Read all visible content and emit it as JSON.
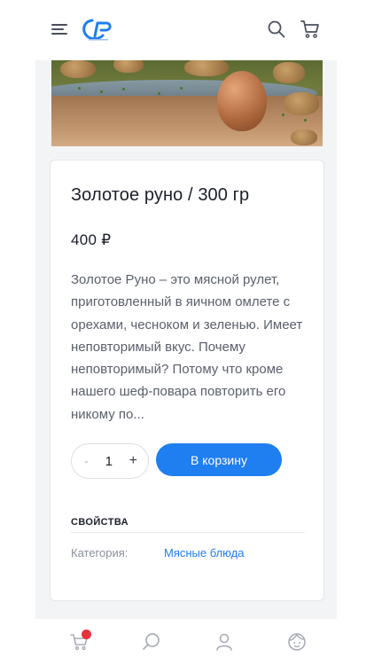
{
  "header": {
    "menu_icon": "hamburger-menu-icon",
    "logo_icon": "brand-logo-icon",
    "search_icon": "search-icon",
    "cart_icon": "cart-icon"
  },
  "product": {
    "title": "Золотое руно / 300 гр",
    "price": "400 ₽",
    "description": "Золотое Руно – это мясной рулет, приготовленный в яичном омлете с орехами, чесноком и зеленью. Имеет неповторимый вкус. Почему неповторимый? Потому что кроме нашего шеф-повара повторить его никому по...",
    "quantity": {
      "minus": "-",
      "value": "1",
      "plus": "+"
    },
    "add_to_cart": "В корзину",
    "properties": {
      "title": "СВОЙСТВА",
      "category_label": "Категория:",
      "category_value": "Мясные блюда"
    }
  },
  "tabbar": {
    "items": [
      {
        "icon": "cart-icon"
      },
      {
        "icon": "search-icon"
      },
      {
        "icon": "user-icon"
      },
      {
        "icon": "face-profile-icon"
      }
    ]
  },
  "colors": {
    "accent": "#1f7ef0",
    "badge": "#e8323c",
    "text": "#1b1f2a",
    "muted": "#5a5f6b"
  }
}
